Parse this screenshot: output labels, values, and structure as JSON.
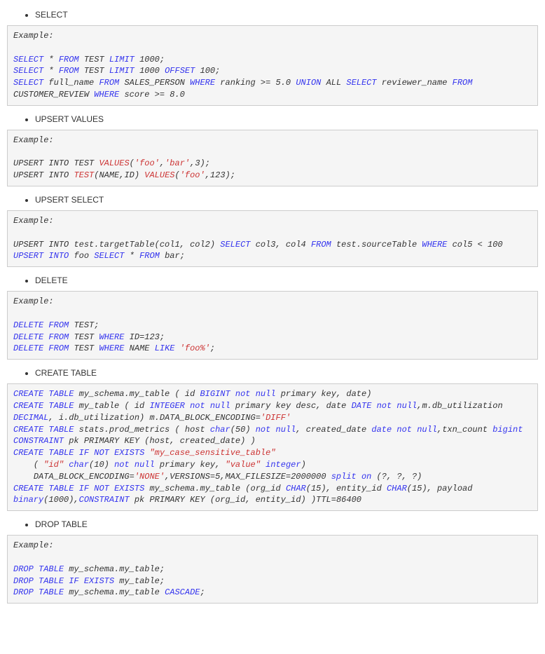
{
  "sections": {
    "select": {
      "title": "SELECT",
      "label": "Example:",
      "lines": {
        "l1_pre": "SELECT * FROM TEST LIMIT 1000;",
        "l2_pre": "SELECT * FROM TEST LIMIT 1000 OFFSET 100;",
        "l3_pre": "SELECT full_name FROM SALES_PERSON WHERE ranking >= 5.0 UNION ALL SELECT reviewer_name FROM CUSTOMER_REVIEW WHERE score >= 8.0"
      }
    },
    "upsert_values": {
      "title": "UPSERT VALUES",
      "label": "Example:",
      "lines": {
        "l1": "UPSERT INTO TEST VALUES('foo','bar',3);",
        "l2": "UPSERT INTO TEST(NAME,ID) VALUES('foo',123);"
      }
    },
    "upsert_select": {
      "title": "UPSERT SELECT",
      "label": "Example:",
      "lines": {
        "l1": "UPSERT INTO test.targetTable(col1, col2) SELECT col3, col4 FROM test.sourceTable WHERE col5 < 100",
        "l2": "UPSERT INTO foo SELECT * FROM bar;"
      }
    },
    "delete": {
      "title": "DELETE",
      "label": "Example:",
      "lines": {
        "l1": "DELETE FROM TEST;",
        "l2": "DELETE FROM TEST WHERE ID=123;",
        "l3": "DELETE FROM TEST WHERE NAME LIKE 'foo%';"
      }
    },
    "create_table": {
      "title": "CREATE TABLE",
      "lines": {
        "l1": "CREATE TABLE my_schema.my_table ( id BIGINT not null primary key, date)",
        "l2": "CREATE TABLE my_table ( id INTEGER not null primary key desc, date DATE not null,m.db_utilization DECIMAL, i.db_utilization) m.DATA_BLOCK_ENCODING='DIFF'",
        "l3": "CREATE TABLE stats.prod_metrics ( host char(50) not null, created_date date not null,txn_count bigint CONSTRAINT pk PRIMARY KEY (host, created_date) )",
        "l4": "CREATE TABLE IF NOT EXISTS \"my_case_sensitive_table\"",
        "l5": "    ( \"id\" char(10) not null primary key, \"value\" integer)",
        "l6": "    DATA_BLOCK_ENCODING='NONE',VERSIONS=5,MAX_FILESIZE=2000000 split on (?, ?, ?)",
        "l7": "CREATE TABLE IF NOT EXISTS my_schema.my_table (org_id CHAR(15), entity_id CHAR(15), payload binary(1000),CONSTRAINT pk PRIMARY KEY (org_id, entity_id) )TTL=86400"
      }
    },
    "drop_table": {
      "title": "DROP TABLE",
      "label": "Example:",
      "lines": {
        "l1": "DROP TABLE my_schema.my_table;",
        "l2": "DROP TABLE IF EXISTS my_table;",
        "l3": "DROP TABLE my_schema.my_table CASCADE;"
      }
    }
  },
  "tokens": {
    "select": "SELECT",
    "from": "FROM",
    "limit": "LIMIT",
    "offset": "OFFSET",
    "where": "WHERE",
    "union": "UNION",
    "all": "ALL",
    "upsert": "UPSERT",
    "into": "INTO",
    "values": "VALUES",
    "delete": "DELETE",
    "like": "LIKE",
    "create": "CREATE",
    "table": "TABLE",
    "bigint": "BIGINT",
    "integer": "INTEGER",
    "decimal": "DECIMAL",
    "date_t": "DATE",
    "char_t": "CHAR",
    "not": "not",
    "null": "null",
    "primary": "primary",
    "key": "key",
    "desc": "desc",
    "constraint": "CONSTRAINT",
    "pk_primary": "PRIMARY",
    "pk_key": "KEY",
    "if": "IF",
    "not_u": "NOT",
    "exists": "EXISTS",
    "split": "split",
    "on": "on",
    "drop": "DROP",
    "cascade": "CASCADE",
    "binary": "binary",
    "char_l": "char",
    "date_l": "date",
    "bigint_l": "bigint",
    "integer_l": "integer"
  },
  "ids": {
    "star": "*",
    "test": "TEST",
    "thousand": "1000",
    "hundred": "100",
    "full_name": "full_name",
    "sales_person": "SALES_PERSON",
    "ranking": "ranking",
    "five": "5.0",
    "reviewer_name": "reviewer_name",
    "customer_review": "CUSTOMER_REVIEW",
    "score": "score",
    "eight": "8.0",
    "name_id": "NAME,ID",
    "testname": "TEST",
    "my_schema_my_table": "my_schema.my_table",
    "my_table": "my_table",
    "id": "id",
    "date": "date",
    "org_id": "org_id",
    "entity_id": "entity_id",
    "pk": "pk",
    "stats_prod": "stats.prod_metrics",
    "host": "host",
    "created_date": "created_date",
    "txn_count": "txn_count",
    "data_block_enc": "DATA_BLOCK_ENCODING",
    "versions": "VERSIONS",
    "max_filesize": "MAX_FILESIZE",
    "ttl": "TTL",
    "eq86400": "86400",
    "fifty": "50",
    "ten": "10",
    "fifteen": "15",
    "onethousand": "1000",
    "five_v": "5",
    "twomil": "2000000",
    "payload": "payload",
    "col12": "col1, col2",
    "col3": "col3",
    "col4": "col4",
    "col5": "col5",
    "lt100": "100",
    "foo": "foo",
    "bar": "bar",
    "target": "test.targetTable",
    "source": "test.sourceTable",
    "m_db_util": "m.db_utilization",
    "i_db_util": "i.db_utilization",
    "m_dbe": "m.DATA_BLOCK_ENCODING",
    "ID": "ID",
    "v123": "123",
    "NAME": "NAME",
    "q_id": "\"id\"",
    "q_value": "\"value\"",
    "q_table": "\"my_case_sensitive_table\"",
    "three": "3",
    "onetwothree": "123"
  },
  "strings": {
    "foo": "'foo'",
    "bar": "'bar'",
    "foo_pct": "'foo%'",
    "diff": "'DIFF'",
    "none": "'NONE'"
  }
}
